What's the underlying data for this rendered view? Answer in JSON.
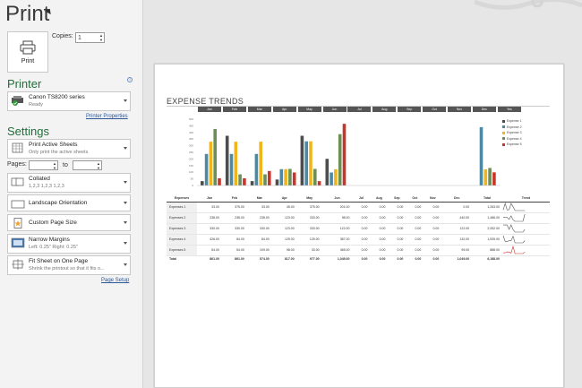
{
  "app": {
    "title": "Print"
  },
  "print_button": {
    "label": "Print"
  },
  "copies": {
    "label": "Copies:",
    "value": "1"
  },
  "printer": {
    "heading": "Printer",
    "name": "Canon TS8200 series",
    "status": "Ready",
    "properties_link": "Printer Properties"
  },
  "settings": {
    "heading": "Settings",
    "print_what": {
      "main": "Print Active Sheets",
      "sub": "Only print the active sheets"
    },
    "pages_label": "Pages:",
    "to_label": "to",
    "collate": {
      "main": "Collated",
      "sub": "1,2,3    1,2,3    1,2,3"
    },
    "orientation": {
      "main": "Landscape Orientation"
    },
    "paper": {
      "main": "Custom Page Size"
    },
    "margins": {
      "main": "Narrow Margins",
      "sub": "Left:  0.25\"    Right:  0.25\""
    },
    "scaling": {
      "main": "Fit Sheet on One Page",
      "sub": "Shrink the printout so that it fits o..."
    },
    "page_setup_link": "Page Setup"
  },
  "preview": {
    "title": "EXPENSE TRENDS",
    "months": [
      "Jan",
      "Feb",
      "Mar",
      "Apr",
      "May",
      "Jun",
      "Jul",
      "Aug",
      "Sep",
      "Oct",
      "Nov",
      "Dec",
      "Yes"
    ],
    "table_headers": [
      "Expenses",
      "Jan",
      "Feb",
      "Mar",
      "Apr",
      "May",
      "Jun",
      "Jul",
      "Aug",
      "Sep",
      "Oct",
      "Nov",
      "Dec",
      "Total",
      "Trend"
    ],
    "rows": [
      [
        "Expenses 1",
        "33.00",
        "375.00",
        "33.00",
        "45.00",
        "375.00",
        "201.00",
        "0.00",
        "0.00",
        "0.00",
        "0.00",
        "0.00",
        "0.00",
        "1,263.00"
      ],
      [
        "Expenses 2",
        "238.00",
        "238.00",
        "238.00",
        "123.00",
        "333.00",
        "98.00",
        "0.00",
        "0.00",
        "0.00",
        "0.00",
        "0.00",
        "440.00",
        "1,486.00"
      ],
      [
        "Expenses 3",
        "330.00",
        "330.00",
        "330.00",
        "123.00",
        "333.00",
        "122.00",
        "0.00",
        "0.00",
        "0.00",
        "0.00",
        "0.00",
        "122.00",
        "2,052.00"
      ],
      [
        "Expenses 4",
        "426.00",
        "84.00",
        "84.00",
        "125.00",
        "125.00",
        "387.00",
        "0.00",
        "0.00",
        "0.00",
        "0.00",
        "0.00",
        "132.00",
        "1,539.00"
      ],
      [
        "Expenses 5",
        "54.00",
        "54.00",
        "109.00",
        "98.00",
        "33.00",
        "465.00",
        "0.00",
        "0.00",
        "0.00",
        "0.00",
        "0.00",
        "99.00",
        "888.00"
      ]
    ],
    "total_row": [
      "Total",
      "861.00",
      "861.00",
      "574.00",
      "817.00",
      "977.00",
      "1,049.00",
      "0.00",
      "0.00",
      "0.00",
      "0.00",
      "0.00",
      "1,049.00",
      "6,188.00"
    ]
  },
  "chart_data": {
    "type": "bar",
    "title": "",
    "categories": [
      "Jan",
      "Feb",
      "Mar",
      "Apr",
      "May",
      "Jun",
      "Jul",
      "Aug",
      "Sep",
      "Oct",
      "Nov",
      "Dec"
    ],
    "ylim": [
      0,
      500
    ],
    "yticks": [
      "500",
      "450",
      "400",
      "350",
      "300",
      "250",
      "200",
      "150",
      "100",
      "50",
      "0"
    ],
    "series": [
      {
        "name": "Expense 1",
        "color": "#4d4d4d",
        "values": [
          33,
          375,
          33,
          45,
          375,
          201,
          0,
          0,
          0,
          0,
          0,
          0
        ]
      },
      {
        "name": "Expense 2",
        "color": "#4a8aa5",
        "values": [
          238,
          238,
          238,
          123,
          333,
          98,
          0,
          0,
          0,
          0,
          0,
          440
        ]
      },
      {
        "name": "Expense 3",
        "color": "#f0b41c",
        "values": [
          330,
          330,
          330,
          123,
          333,
          122,
          0,
          0,
          0,
          0,
          0,
          122
        ]
      },
      {
        "name": "Expense 4",
        "color": "#6b8f57",
        "values": [
          426,
          84,
          84,
          125,
          125,
          387,
          0,
          0,
          0,
          0,
          0,
          132
        ]
      },
      {
        "name": "Expense 5",
        "color": "#c8352a",
        "values": [
          54,
          54,
          109,
          98,
          33,
          465,
          0,
          0,
          0,
          0,
          0,
          99
        ]
      }
    ],
    "legend": "right"
  }
}
